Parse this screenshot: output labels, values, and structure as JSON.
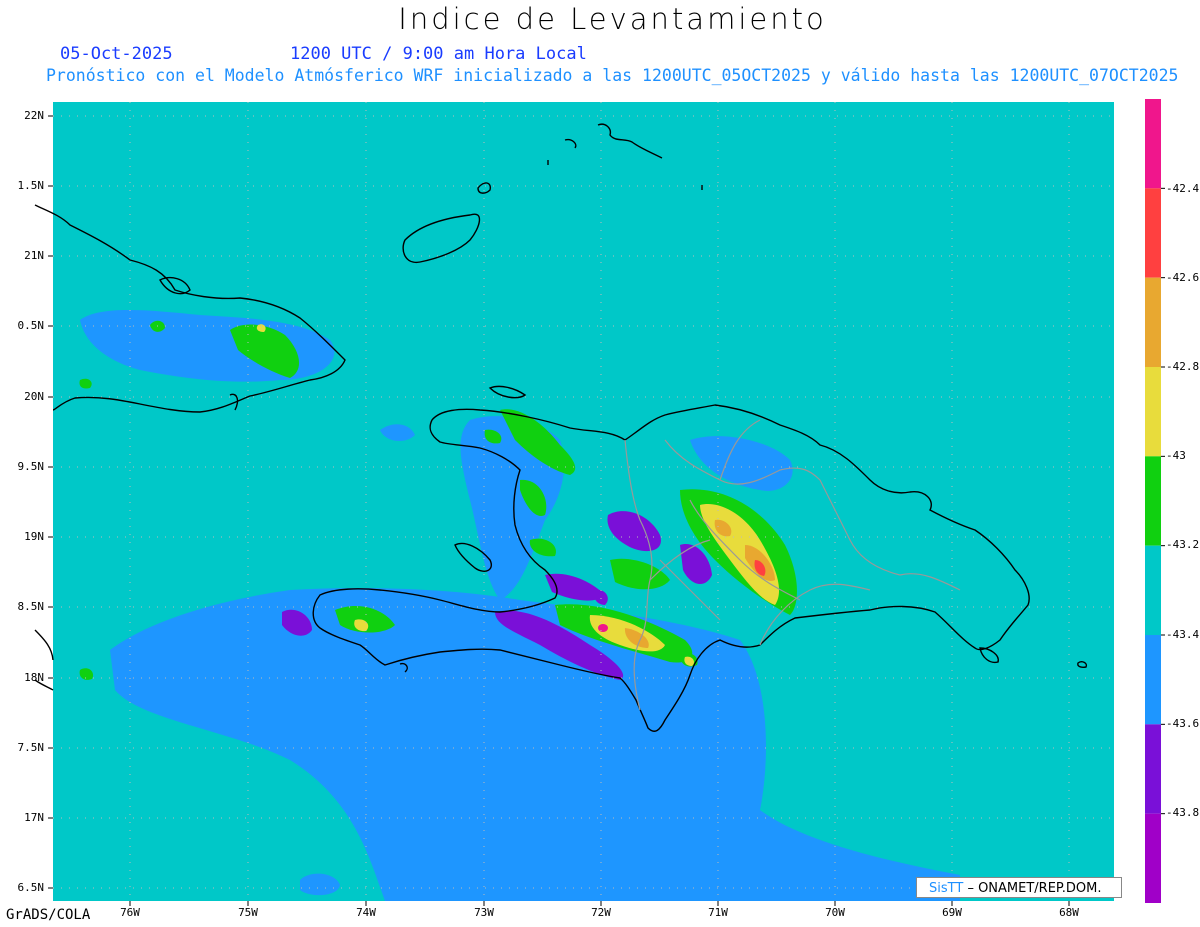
{
  "header": {
    "title": "Indice de Levantamiento",
    "date": "05-Oct-2025",
    "time": "1200 UTC / 9:00 am Hora Local",
    "subtitle": "Pronóstico con el Modelo Atmósferico WRF inicializado a las 1200UTC_05OCT2025 y válido hasta las  1200UTC_07OCT2025"
  },
  "axes": {
    "lat_labels": [
      "22N",
      "1.5N",
      "21N",
      "0.5N",
      "20N",
      "9.5N",
      "19N",
      "8.5N",
      "18N",
      "7.5N",
      "17N",
      "6.5N"
    ],
    "lon_labels": [
      "76W",
      "75W",
      "74W",
      "73W",
      "72W",
      "71W",
      "70W",
      "69W",
      "68W"
    ]
  },
  "colorbar": {
    "labels": [
      "-42.4",
      "-42.6",
      "-42.8",
      "-43",
      "-43.2",
      "-43.4",
      "-43.6",
      "-43.8"
    ],
    "colors": [
      "#f0168c",
      "#ff4040",
      "#e8a830",
      "#e8dc3c",
      "#10d010",
      "#00c8c8",
      "#1e96ff",
      "#7a10d8",
      "#a000c8"
    ]
  },
  "footer": {
    "software": "GrADS/COLA",
    "credit_logo": "SisTT",
    "credit_text": "– ONAMET/REP.DOM."
  }
}
